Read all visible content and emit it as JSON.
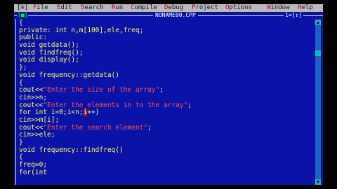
{
  "menu": {
    "system": "[≡]",
    "items": [
      "File",
      "Edit",
      "Search",
      "Run",
      "Compile",
      "Debug",
      "Project",
      "Options",
      "Window",
      "Help"
    ]
  },
  "window": {
    "close_box": "[■]",
    "filename": "NONAME00.CPP",
    "window_number": "1=[↕]"
  },
  "code": [
    [
      {
        "t": "{",
        "c": "code"
      }
    ],
    [
      {
        "t": "private: int n,m[100],ele,freq;",
        "c": "code"
      }
    ],
    [
      {
        "t": "public:",
        "c": "code"
      }
    ],
    [
      {
        "t": "void getdata();",
        "c": "code"
      }
    ],
    [
      {
        "t": "void findfreq();",
        "c": "code"
      }
    ],
    [
      {
        "t": "void display();",
        "c": "code"
      }
    ],
    [
      {
        "t": "};",
        "c": "code"
      }
    ],
    [
      {
        "t": "void frequency::getdata()",
        "c": "code"
      }
    ],
    [
      {
        "t": "{",
        "c": "code"
      }
    ],
    [
      {
        "t": "cout<<",
        "c": "code"
      },
      {
        "t": "\"Enter the size of the array\"",
        "c": "str"
      },
      {
        "t": ";",
        "c": "code"
      }
    ],
    [
      {
        "t": "cin>>n;",
        "c": "code"
      }
    ],
    [
      {
        "t": "cout<<",
        "c": "code"
      },
      {
        "t": "\"Enter the elements in to the array\"",
        "c": "str"
      },
      {
        "t": ";",
        "c": "code"
      }
    ],
    [
      {
        "t": "for int i=0;i<n;",
        "c": "code"
      },
      {
        "t": "i",
        "c": "hl"
      },
      {
        "t": "++)",
        "c": "code"
      }
    ],
    [
      {
        "t": "cin>>m[i];",
        "c": "code"
      }
    ],
    [
      {
        "t": "cout<<",
        "c": "code"
      },
      {
        "t": "\"Enter the search element\"",
        "c": "str"
      },
      {
        "t": ";",
        "c": "code"
      }
    ],
    [
      {
        "t": "cin>>ele;",
        "c": "code"
      }
    ],
    [
      {
        "t": "}",
        "c": "code"
      }
    ],
    [
      {
        "t": "void frequency::findfreq()",
        "c": "code"
      }
    ],
    [
      {
        "t": "{",
        "c": "code"
      }
    ],
    [
      {
        "t": "freq=0;",
        "c": "code"
      }
    ],
    [
      {
        "t": "for(int",
        "c": "code"
      }
    ]
  ],
  "scrollbar": {
    "up": "▲",
    "down": "▼"
  },
  "colors": {
    "background": "#0b12a8",
    "code": "#ffff55",
    "string": "#ff5050",
    "menubar": "#b9b9b9"
  }
}
